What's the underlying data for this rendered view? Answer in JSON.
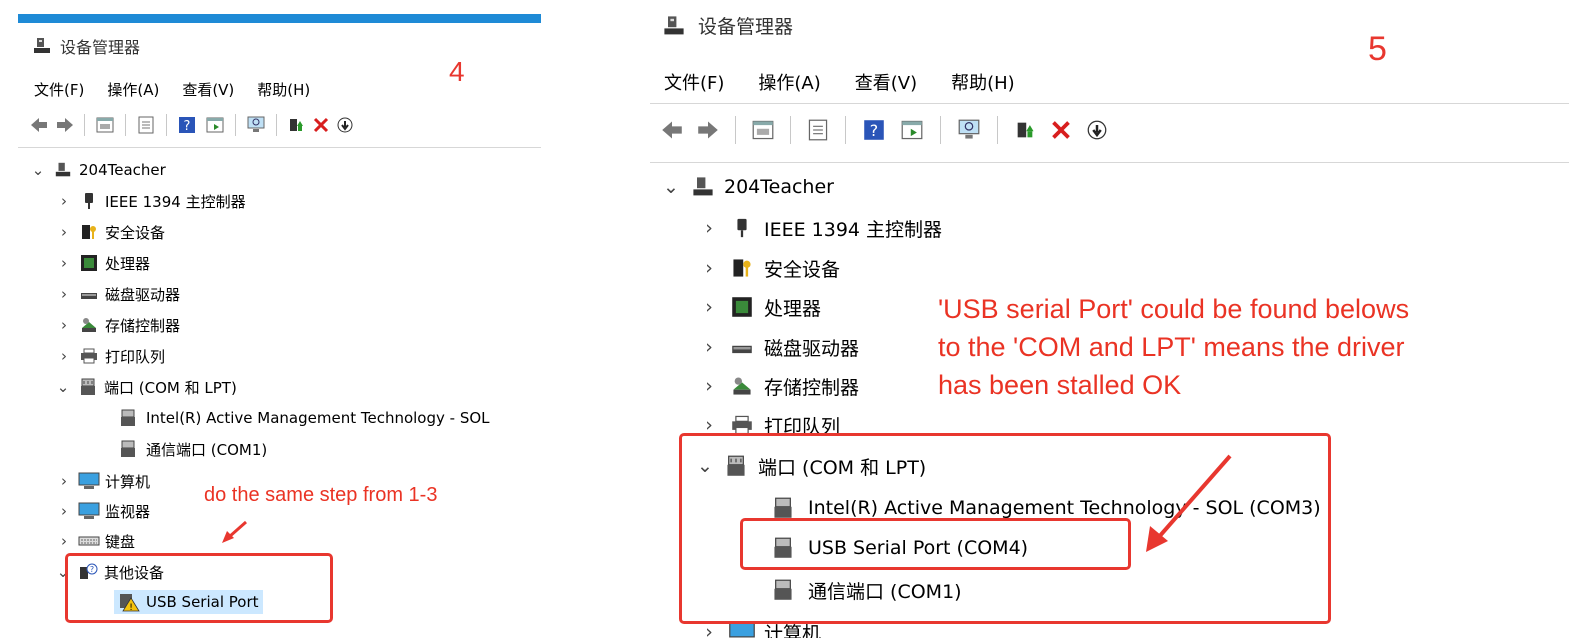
{
  "title": "设备管理器",
  "menu": [
    "文件(F)",
    "操作(A)",
    "查看(V)",
    "帮助(H)"
  ],
  "toolbar_icons": [
    "back-arrow-icon",
    "forward-arrow-icon",
    "properties-icon",
    "show-hidden-icon",
    "help-icon",
    "action-icon",
    "scan-icon",
    "update-driver-icon",
    "uninstall-icon",
    "disable-icon"
  ],
  "colors": {
    "accent_bar": "#1e8ad6",
    "annotation_red": "#e8372f",
    "selection": "#cce8ff"
  },
  "left": {
    "step": "4",
    "root": "204Teacher",
    "categories": {
      "ieee1394": "IEEE 1394 主控制器",
      "security": "安全设备",
      "processor": "处理器",
      "disk": "磁盘驱动器",
      "storage": "存储控制器",
      "print": "打印队列",
      "ports": "端口 (COM 和 LPT)",
      "computer": "计算机",
      "monitor": "监视器",
      "keyboard": "键盘",
      "other": "其他设备"
    },
    "ports_children": [
      "Intel(R) Active Management Technology - SOL",
      "通信端口 (COM1)"
    ],
    "other_children": [
      "USB Serial Port"
    ],
    "annotation": "do the same step from 1-3"
  },
  "right": {
    "step": "5",
    "root": "204Teacher",
    "categories": {
      "ieee1394": "IEEE 1394 主控制器",
      "security": "安全设备",
      "processor": "处理器",
      "disk": "磁盘驱动器",
      "storage": "存储控制器",
      "print": "打印队列",
      "ports": "端口 (COM 和 LPT)",
      "computer": "计算机"
    },
    "ports_children": [
      "Intel(R) Active Management Technology - SOL (COM3)",
      "USB Serial Port (COM4)",
      "通信端口 (COM1)"
    ],
    "annotation_lines": [
      "'USB serial Port' could be found belows",
      "to the 'COM and LPT' means the driver",
      "has been stalled OK"
    ]
  }
}
